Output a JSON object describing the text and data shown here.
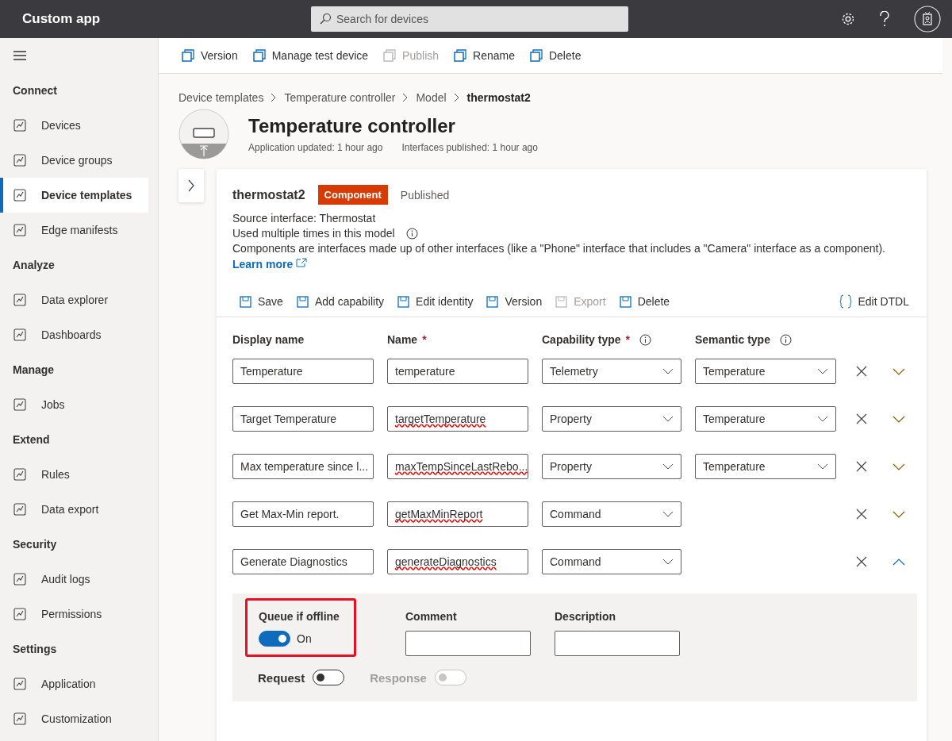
{
  "top_bar": {
    "app_title": "Custom app",
    "search": {
      "placeholder": "Search for devices"
    }
  },
  "sidebar": {
    "sections": [
      {
        "title": "Connect",
        "items": [
          {
            "label": "Devices",
            "selected": false
          },
          {
            "label": "Device groups",
            "selected": false
          },
          {
            "label": "Device templates",
            "selected": true
          },
          {
            "label": "Edge manifests",
            "selected": false
          }
        ]
      },
      {
        "title": "Analyze",
        "items": [
          {
            "label": "Data explorer",
            "selected": false
          },
          {
            "label": "Dashboards",
            "selected": false
          }
        ]
      },
      {
        "title": "Manage",
        "items": [
          {
            "label": "Jobs",
            "selected": false
          }
        ]
      },
      {
        "title": "Extend",
        "items": [
          {
            "label": "Rules",
            "selected": false
          },
          {
            "label": "Data export",
            "selected": false
          }
        ]
      },
      {
        "title": "Security",
        "items": [
          {
            "label": "Audit logs",
            "selected": false
          },
          {
            "label": "Permissions",
            "selected": false
          }
        ]
      },
      {
        "title": "Settings",
        "items": [
          {
            "label": "Application",
            "selected": false
          },
          {
            "label": "Customization",
            "selected": false
          }
        ]
      }
    ]
  },
  "toolbar": [
    {
      "label": "Version",
      "disabled": false
    },
    {
      "label": "Manage test device",
      "disabled": false
    },
    {
      "label": "Publish",
      "disabled": true
    },
    {
      "label": "Rename",
      "disabled": false
    },
    {
      "label": "Delete",
      "disabled": false
    }
  ],
  "breadcrumb": [
    "Device templates",
    "Temperature controller",
    "Model",
    "thermostat2"
  ],
  "header": {
    "title": "Temperature controller",
    "meta": [
      "Application updated: 1 hour ago",
      "Interfaces published: 1 hour ago"
    ]
  },
  "component": {
    "name": "thermostat2",
    "badge": "Component",
    "status": "Published",
    "source": "Source interface: Thermostat",
    "usage": "Used multiple times in this model",
    "description": "Components are interfaces made up of other interfaces (like a \"Phone\" interface that includes a \"Camera\" interface as a component).",
    "learn_more": "Learn more"
  },
  "commands": [
    {
      "label": "Save",
      "disabled": false
    },
    {
      "label": "Add capability",
      "disabled": false
    },
    {
      "label": "Edit identity",
      "disabled": false
    },
    {
      "label": "Version",
      "disabled": false
    },
    {
      "label": "Export",
      "disabled": true
    },
    {
      "label": "Delete",
      "disabled": false
    }
  ],
  "edit_dtdl": "Edit DTDL",
  "columns": [
    {
      "label": "Display name"
    },
    {
      "label": "Name",
      "required_mark": "*"
    },
    {
      "label": "Capability type",
      "required_mark": "*",
      "info": true
    },
    {
      "label": "Semantic type",
      "info": true
    }
  ],
  "capabilities": [
    {
      "display_name": "Temperature",
      "name": "temperature",
      "name_misspelled": false,
      "capability_type": "Telemetry",
      "semantic_type": "Temperature",
      "expanded": false
    },
    {
      "display_name": "Target Temperature",
      "name": "targetTemperature",
      "name_misspelled": true,
      "capability_type": "Property",
      "semantic_type": "Temperature",
      "expanded": false
    },
    {
      "display_name": "Max temperature since l...",
      "name": "maxTempSinceLastRebo...",
      "name_misspelled": true,
      "capability_type": "Property",
      "semantic_type": "Temperature",
      "expanded": false
    },
    {
      "display_name": "Get Max-Min report.",
      "name": "getMaxMinReport",
      "name_misspelled": true,
      "capability_type": "Command",
      "expanded": false
    },
    {
      "display_name": "Generate Diagnostics",
      "name": "generateDiagnostics",
      "name_misspelled": true,
      "capability_type": "Command",
      "expanded": true
    }
  ],
  "details": {
    "queue_if_offline": {
      "label": "Queue if offline",
      "on": true,
      "state_text": "On",
      "highlighted": true
    },
    "comment": {
      "label": "Comment"
    },
    "description": {
      "label": "Description"
    },
    "toggles": [
      {
        "label": "Request",
        "on": false,
        "disabled": false
      },
      {
        "label": "Response",
        "on": false,
        "disabled": true
      }
    ]
  }
}
